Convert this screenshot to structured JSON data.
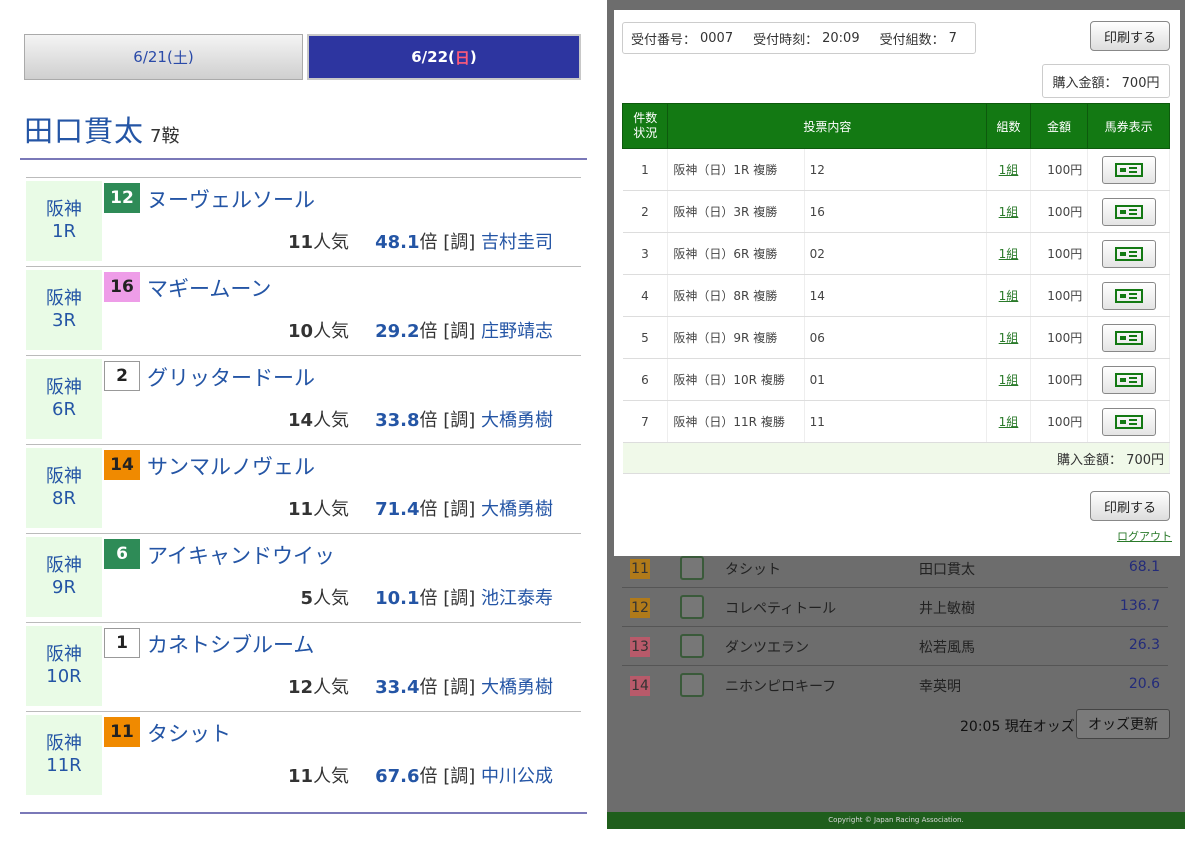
{
  "left": {
    "tabs": [
      {
        "label_pre": "6/21(",
        "label_day": "土",
        "label_post": ")"
      },
      {
        "label_pre": "6/22(",
        "label_day": "日",
        "label_post": ")"
      }
    ],
    "jockey_name": "田口貫太",
    "ride_count": "7鞍",
    "races": [
      {
        "venue": "阪神",
        "race": "1R",
        "num": "12",
        "num_color": "#2e8b57",
        "num_text": "#ffffff",
        "horse": "ヌーヴェルソール",
        "pop": "11",
        "pop_unit": "人気",
        "odds": "48.1",
        "odds_unit": "倍",
        "tag": "[調]",
        "trainer": "吉村圭司"
      },
      {
        "venue": "阪神",
        "race": "3R",
        "num": "16",
        "num_color": "#ee9de8",
        "num_text": "#222222",
        "horse": "マギームーン",
        "pop": "10",
        "pop_unit": "人気",
        "odds": "29.2",
        "odds_unit": "倍",
        "tag": "[調]",
        "trainer": "庄野靖志"
      },
      {
        "venue": "阪神",
        "race": "6R",
        "num": "2",
        "num_color": "#ffffff",
        "num_text": "#222222",
        "horse": "グリッタードール",
        "pop": "14",
        "pop_unit": "人気",
        "odds": "33.8",
        "odds_unit": "倍",
        "tag": "[調]",
        "trainer": "大橋勇樹"
      },
      {
        "venue": "阪神",
        "race": "8R",
        "num": "14",
        "num_color": "#f08a00",
        "num_text": "#222222",
        "horse": "サンマルノヴェル",
        "pop": "11",
        "pop_unit": "人気",
        "odds": "71.4",
        "odds_unit": "倍",
        "tag": "[調]",
        "trainer": "大橋勇樹"
      },
      {
        "venue": "阪神",
        "race": "9R",
        "num": "6",
        "num_color": "#2e8b57",
        "num_text": "#ffffff",
        "horse": "アイキャンドウイッ",
        "pop": "5",
        "pop_unit": "人気",
        "odds": "10.1",
        "odds_unit": "倍",
        "tag": "[調]",
        "trainer": "池江泰寿"
      },
      {
        "venue": "阪神",
        "race": "10R",
        "num": "1",
        "num_color": "#ffffff",
        "num_text": "#222222",
        "horse": "カネトシブルーム",
        "pop": "12",
        "pop_unit": "人気",
        "odds": "33.4",
        "odds_unit": "倍",
        "tag": "[調]",
        "trainer": "大橋勇樹"
      },
      {
        "venue": "阪神",
        "race": "11R",
        "num": "11",
        "num_color": "#f08a00",
        "num_text": "#222222",
        "horse": "タシット",
        "pop": "11",
        "pop_unit": "人気",
        "odds": "67.6",
        "odds_unit": "倍",
        "tag": "[調]",
        "trainer": "中川公成"
      }
    ]
  },
  "right": {
    "receipt": {
      "no_label": "受付番号：",
      "no_value": "0007",
      "time_label": "受付時刻：",
      "time_value": "20:09",
      "sets_label": "受付組数：",
      "sets_value": "7"
    },
    "print_label": "印刷する",
    "amount_top": "購入金額： 700円",
    "headers": {
      "count": "件数状況",
      "content": "投票内容",
      "sets": "組数",
      "amount": "金額",
      "ticket": "馬券表示"
    },
    "bets": [
      {
        "n": "1",
        "race": "阪神（日）1R 複勝",
        "sel": "12",
        "sets": "1組",
        "amt": "100円"
      },
      {
        "n": "2",
        "race": "阪神（日）3R 複勝",
        "sel": "16",
        "sets": "1組",
        "amt": "100円"
      },
      {
        "n": "3",
        "race": "阪神（日）6R 複勝",
        "sel": "02",
        "sets": "1組",
        "amt": "100円"
      },
      {
        "n": "4",
        "race": "阪神（日）8R 複勝",
        "sel": "14",
        "sets": "1組",
        "amt": "100円"
      },
      {
        "n": "5",
        "race": "阪神（日）9R 複勝",
        "sel": "06",
        "sets": "1組",
        "amt": "100円"
      },
      {
        "n": "6",
        "race": "阪神（日）10R 複勝",
        "sel": "01",
        "sets": "1組",
        "amt": "100円"
      },
      {
        "n": "7",
        "race": "阪神（日）11R 複勝",
        "sel": "11",
        "sets": "1組",
        "amt": "100円"
      }
    ],
    "total_label": "購入金額： 700円",
    "logout": "ログアウト",
    "odds_rows": [
      {
        "num": "11",
        "color": "#b07a1a",
        "name": "タシット",
        "jockey": "田口貫太",
        "odds": "68.1"
      },
      {
        "num": "12",
        "color": "#b07a1a",
        "name": "コレペティトール",
        "jockey": "井上敏樹",
        "odds": "136.7"
      },
      {
        "num": "13",
        "color": "#b85a6a",
        "name": "ダンツエラン",
        "jockey": "松若風馬",
        "odds": "26.3"
      },
      {
        "num": "14",
        "color": "#b85a6a",
        "name": "ニホンピロキーフ",
        "jockey": "幸英明",
        "odds": "20.6"
      }
    ],
    "odds_time": "20:05 現在オッズ",
    "odds_update": "オッズ更新",
    "copyright": "Copyright © Japan Racing Association."
  }
}
